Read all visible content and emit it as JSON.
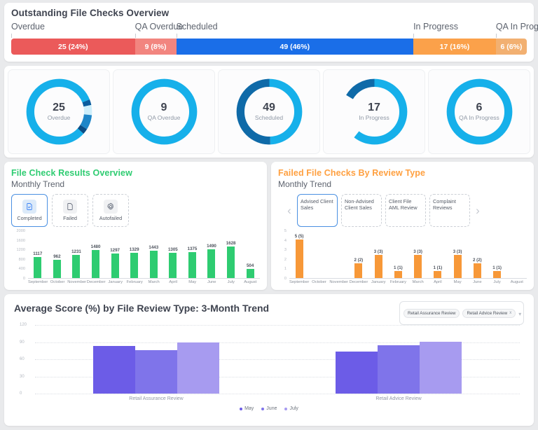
{
  "overview": {
    "title": "Outstanding File Checks Overview",
    "segments": [
      {
        "label": "Overdue",
        "value": 25,
        "percent": 24,
        "text": "25 (24%)",
        "color": "#eb5a5a"
      },
      {
        "label": "QA Overdue",
        "value": 9,
        "percent": 8,
        "text": "9 (8%)",
        "color": "#f2857f"
      },
      {
        "label": "Scheduled",
        "value": 49,
        "percent": 46,
        "text": "49 (46%)",
        "color": "#1a6ee8"
      },
      {
        "label": "In Progress",
        "value": 17,
        "percent": 16,
        "text": "17 (16%)",
        "color": "#fba14a"
      },
      {
        "label": "QA In Progre..",
        "value": 6,
        "percent": 6,
        "text": "6 (6%)",
        "color": "#f2b071"
      }
    ]
  },
  "donuts": [
    {
      "value": "25",
      "label": "Overdue"
    },
    {
      "value": "9",
      "label": "QA Overdue"
    },
    {
      "value": "49",
      "label": "Scheduled"
    },
    {
      "value": "17",
      "label": "In Progress"
    },
    {
      "value": "6",
      "label": "QA In Progress"
    }
  ],
  "left_panel": {
    "title": "File Check Results Overview",
    "title_color": "#2ecc71",
    "subtitle": "Monthly Trend",
    "chips": [
      {
        "label": "Completed",
        "icon": "document-check-icon",
        "active": true
      },
      {
        "label": "Failed",
        "icon": "document-icon",
        "active": false
      },
      {
        "label": "Autofailed",
        "icon": "gear-icon",
        "active": false
      }
    ]
  },
  "right_panel": {
    "title": "Failed File Checks By Review Type",
    "title_color": "#ffa040",
    "subtitle": "Monthly Trend",
    "prev_icon": "chevron-left-icon",
    "next_icon": "chevron-right-icon",
    "chips": [
      {
        "label": "Advised Client Sales",
        "active": true
      },
      {
        "label": "Non-Advised Client Sales",
        "active": false
      },
      {
        "label": "Client File AML Review",
        "active": false
      },
      {
        "label": "Complaint Reviews",
        "active": false
      }
    ]
  },
  "bottom": {
    "title": "Average Score (%) by File Review Type: 3-Month Trend",
    "filter": {
      "tags": [
        {
          "label": "Retail Assurance Review",
          "removable": false
        },
        {
          "label": "Retail Advice Review",
          "removable": true,
          "remove_icon": "x"
        }
      ],
      "caret_icon": "chevron-down-icon"
    }
  },
  "chart_data": [
    {
      "type": "bar",
      "title": "File Check Results Overview",
      "subtitle": "Monthly Trend",
      "xlabel": "",
      "ylabel": "",
      "ylim": [
        0,
        2000
      ],
      "yticks": [
        0,
        400,
        800,
        1200,
        1600,
        2000
      ],
      "grid": false,
      "bar_color": "#2ecc71",
      "categories": [
        "September",
        "October",
        "November",
        "December",
        "January",
        "February",
        "March",
        "April",
        "May",
        "June",
        "July",
        "August"
      ],
      "values": [
        1117,
        962,
        1231,
        1480,
        1297,
        1329,
        1443,
        1305,
        1375,
        1490,
        1628,
        504
      ],
      "labels": [
        "1117",
        "962",
        "1231",
        "1480",
        "1297",
        "1329",
        "1443",
        "1305",
        "1375",
        "1490",
        "1628",
        "504"
      ]
    },
    {
      "type": "bar",
      "title": "Failed File Checks By Review Type",
      "subtitle": "Monthly Trend",
      "xlabel": "",
      "ylabel": "",
      "ylim": [
        0,
        5
      ],
      "yticks": [
        0,
        1,
        2,
        3,
        4,
        5
      ],
      "grid": false,
      "bar_color": "#f79838",
      "categories": [
        "September",
        "October",
        "November",
        "December",
        "January",
        "February",
        "March",
        "April",
        "May",
        "June",
        "July",
        "August"
      ],
      "values": [
        5,
        0,
        0,
        2,
        3,
        1,
        3,
        1,
        3,
        2,
        1,
        0
      ],
      "labels": [
        "5 (5)",
        "",
        "",
        "2 (2)",
        "3 (3)",
        "1 (1)",
        "3 (3)",
        "1 (1)",
        "3 (3)",
        "2 (2)",
        "1 (1)",
        ""
      ]
    },
    {
      "type": "bar",
      "title": "Average Score (%) by File Review Type: 3-Month Trend",
      "xlabel": "",
      "ylabel": "",
      "ylim": [
        0,
        120
      ],
      "yticks": [
        0,
        30,
        60,
        90,
        120
      ],
      "grid": true,
      "legend_position": "bottom",
      "categories": [
        "Retail Assurance Review",
        "Retail Advice Review"
      ],
      "series": [
        {
          "name": "May",
          "color": "#6c5ce7",
          "values": [
            83,
            74
          ]
        },
        {
          "name": "June",
          "color": "#7f74ea",
          "values": [
            76,
            84
          ]
        },
        {
          "name": "July",
          "color": "#a79bf0",
          "values": [
            90,
            91
          ]
        }
      ]
    }
  ]
}
